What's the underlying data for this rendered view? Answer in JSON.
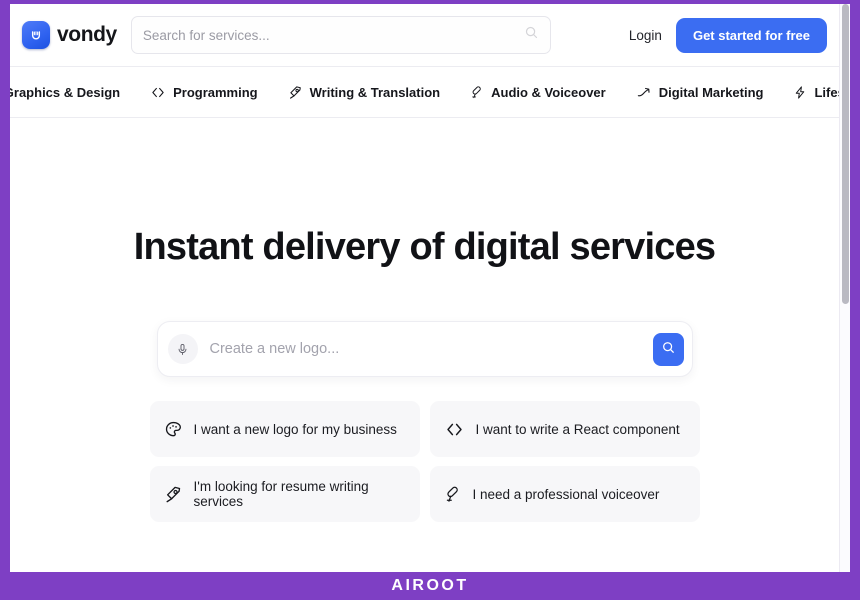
{
  "watermark": "AIROOT",
  "brand": {
    "name": "vondy",
    "logo_icon": "vondy-v-logo-icon",
    "logo_color": "#3b6df2"
  },
  "header": {
    "search": {
      "placeholder": "Search for services...",
      "value": "",
      "icon": "search-icon"
    },
    "login_label": "Login",
    "cta_label": "Get started for free",
    "cta_color": "#3b6df2"
  },
  "catnav": {
    "items": [
      {
        "label": "Graphics & Design",
        "icon": "palette-icon"
      },
      {
        "label": "Programming",
        "icon": "code-brackets-icon"
      },
      {
        "label": "Writing & Translation",
        "icon": "pen-nib-icon"
      },
      {
        "label": "Audio & Voiceover",
        "icon": "microphone-icon"
      },
      {
        "label": "Digital Marketing",
        "icon": "trend-up-icon"
      },
      {
        "label": "Lifestyle",
        "icon": "lightning-bolt-icon"
      }
    ]
  },
  "hero": {
    "headline": "Instant delivery of digital services",
    "prompt": {
      "placeholder": "Create a new logo...",
      "value": "",
      "mic_icon": "microphone-icon",
      "submit_icon": "search-icon",
      "submit_color": "#3b6df2"
    },
    "suggestions": [
      {
        "label": "I want a new logo for my business",
        "icon": "palette-icon"
      },
      {
        "label": "I want to write a React component",
        "icon": "code-brackets-icon"
      },
      {
        "label": "I'm looking for resume writing services",
        "icon": "pen-nib-icon"
      },
      {
        "label": "I need a professional voiceover",
        "icon": "microphone-icon"
      }
    ]
  },
  "scrollbar": {
    "orientation": "vertical"
  },
  "colors": {
    "frame_purple": "#7e3fc4",
    "accent_blue": "#3b6df2",
    "chip_grey": "#f7f7f9"
  }
}
